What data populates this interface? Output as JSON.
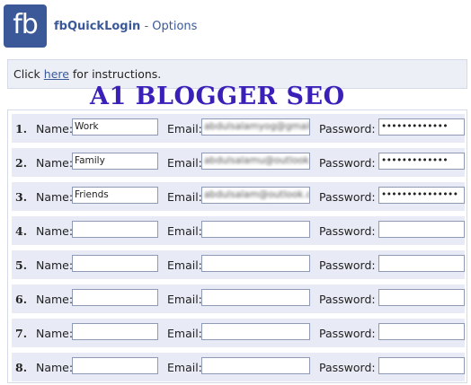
{
  "header": {
    "logo_text": "fb",
    "app_name": "fbQuickLogin",
    "separator": " - ",
    "page_name": "Options"
  },
  "info": {
    "prefix": "Click ",
    "link": "here",
    "suffix": " for instructions."
  },
  "watermark": "A1 BLOGGER SEO",
  "labels": {
    "name": "Name:",
    "email": "Email:",
    "password": "Password:"
  },
  "accounts": [
    {
      "number": "1.",
      "name": "Work",
      "email": "abdulsalamyog@gmail.com",
      "password": "•••••••••••••"
    },
    {
      "number": "2.",
      "name": "Family",
      "email": "abdulsalamu@outlook.com",
      "password": "•••••••••••••"
    },
    {
      "number": "3.",
      "name": "Friends",
      "email": "abdulsalam@outlook.com",
      "password": "•••••••••••••••"
    },
    {
      "number": "4.",
      "name": "",
      "email": "",
      "password": ""
    },
    {
      "number": "5.",
      "name": "",
      "email": "",
      "password": ""
    },
    {
      "number": "6.",
      "name": "",
      "email": "",
      "password": ""
    },
    {
      "number": "7.",
      "name": "",
      "email": "",
      "password": ""
    },
    {
      "number": "8.",
      "name": "",
      "email": "",
      "password": ""
    }
  ]
}
